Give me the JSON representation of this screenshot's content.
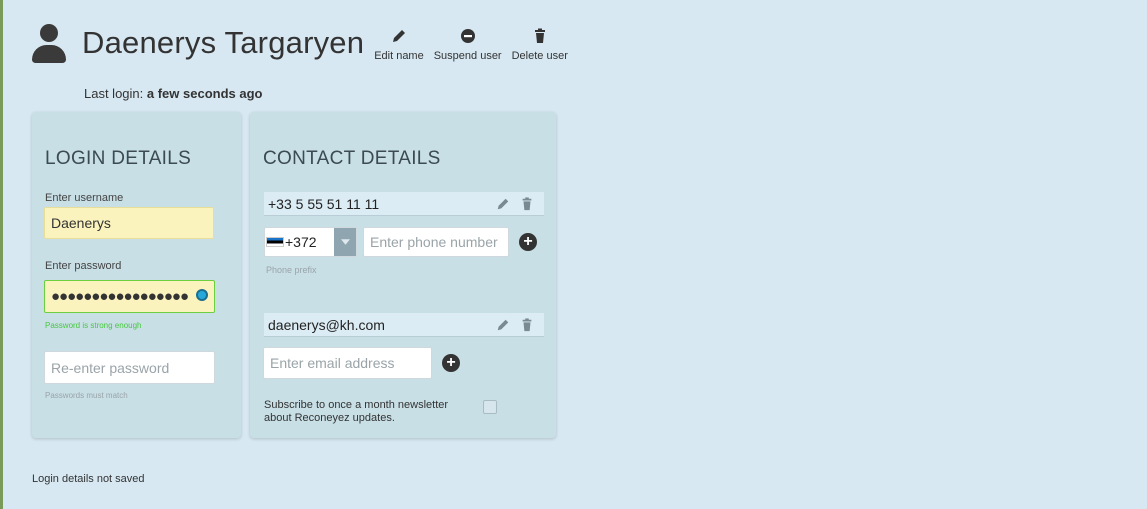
{
  "user": {
    "name": "Daenerys Targaryen",
    "actions": {
      "edit": "Edit name",
      "suspend": "Suspend user",
      "delete": "Delete user"
    },
    "last_login_label": "Last login:",
    "last_login_value": "a few seconds ago"
  },
  "login": {
    "title": "LOGIN DETAILS",
    "username_label": "Enter username",
    "username_value": "Daenerys",
    "password_label": "Enter password",
    "password_mask": "●●●●●●●●●●●●●●●●●",
    "password_hint": "Password is strong enough",
    "reenter_placeholder": "Re-enter password",
    "reenter_hint": "Passwords must match"
  },
  "contact": {
    "title": "CONTACT DETAILS",
    "phone_value": "+33 5 55 51 11 11",
    "prefix_value": "+372",
    "phone_placeholder": "Enter phone number",
    "prefix_hint": "Phone prefix",
    "email_value": "daenerys@kh.com",
    "email_placeholder": "Enter email address",
    "newsletter_text": "Subscribe to once a month newsletter about Reconeyez updates.",
    "newsletter_checked": false
  },
  "status": "Login details not saved",
  "colors": {
    "background": "#d7e8f2",
    "card": "#c8dfe6",
    "strong_hint": "#47c83e"
  }
}
